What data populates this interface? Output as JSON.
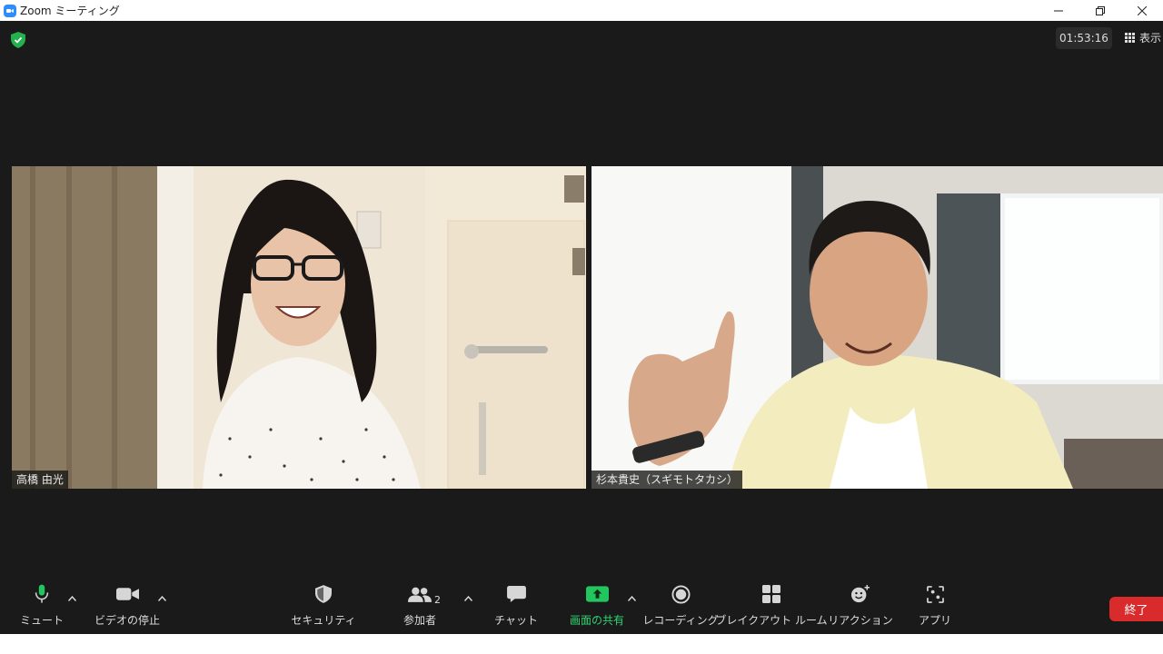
{
  "window": {
    "title": "Zoom ミーティング"
  },
  "meeting": {
    "timer": "01:53:16",
    "view_label": "表示"
  },
  "participants": [
    {
      "name": "高橋 由光"
    },
    {
      "name": "杉本貴史（スギモトタカシ）"
    }
  ],
  "toolbar": {
    "mute_label": "ミュート",
    "video_label": "ビデオの停止",
    "security_label": "セキュリティ",
    "participants_label": "参加者",
    "participants_count": "2",
    "chat_label": "チャット",
    "share_label": "画面の共有",
    "record_label": "レコーディング",
    "breakout_label": "ブレイクアウト ルーム",
    "reactions_label": "リアクション",
    "apps_label": "アプリ",
    "end_label": "終了"
  },
  "colors": {
    "accent": "#2d8cff",
    "share_green": "#2ed573",
    "end_red": "#d92b2b",
    "background": "#1a1a1a"
  }
}
